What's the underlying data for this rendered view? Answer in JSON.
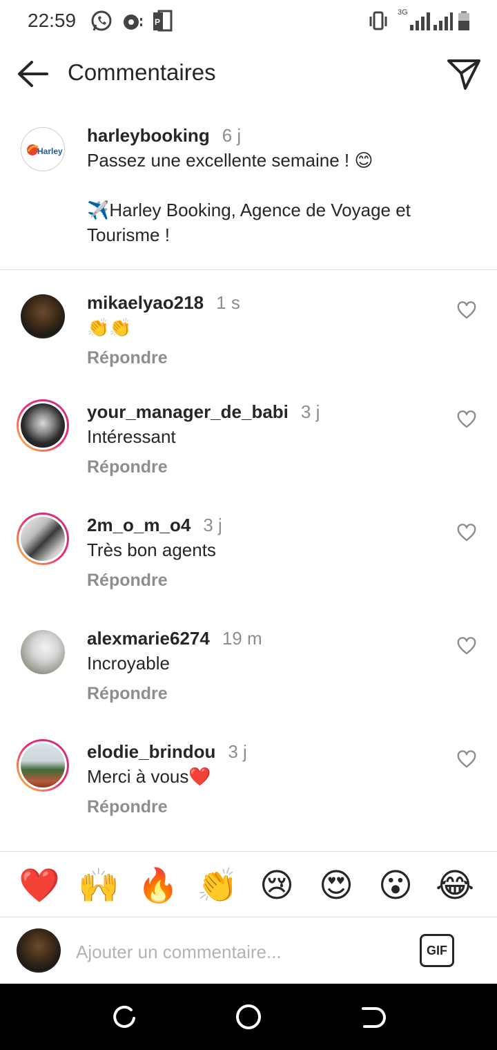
{
  "status_bar": {
    "time": "22:59",
    "left_icons": [
      "whatsapp-icon",
      "media-icon",
      "pdf-icon"
    ],
    "right_icons": [
      "vibrate-icon",
      "signal-3g-icon",
      "signal-icon",
      "battery-icon"
    ],
    "network_label": "3G"
  },
  "header": {
    "title": "Commentaires",
    "back_icon": "arrow-left-icon",
    "send_icon": "send-icon"
  },
  "caption": {
    "username": "harleybooking",
    "time": "6 j",
    "text": "Passez une excellente semaine ! 😊\n\n✈️Harley Booking, Agence de Voyage et Tourisme !",
    "avatar_label": "Harley"
  },
  "comments": [
    {
      "username": "mikaelyao218",
      "time": "1 s",
      "text": "👏👏",
      "reply": "Répondre",
      "story_ring": false
    },
    {
      "username": "your_manager_de_babi",
      "time": "3 j",
      "text": "Intéressant",
      "reply": "Répondre",
      "story_ring": true
    },
    {
      "username": "2m_o_m_o4",
      "time": "3 j",
      "text": "Très bon agents",
      "reply": "Répondre",
      "story_ring": true
    },
    {
      "username": "alexmarie6274",
      "time": "19 m",
      "text": "Incroyable",
      "reply": "Répondre",
      "story_ring": false
    },
    {
      "username": "elodie_brindou",
      "time": "3 j",
      "text": "Merci à vous❤️",
      "reply": "Répondre",
      "story_ring": true
    }
  ],
  "emoji_bar": [
    "❤️",
    "🙌",
    "🔥",
    "👏",
    "😢",
    "😍",
    "😮",
    "😂"
  ],
  "input": {
    "placeholder": "Ajouter un commentaire...",
    "value": "",
    "gif_label": "GIF"
  },
  "colors": {
    "text": "#262626",
    "muted": "#8e8e8e",
    "divider": "#dbdbdb",
    "story_gradient": [
      "#f9ce34",
      "#ee2a7b",
      "#c13584"
    ],
    "heart": "#ed4956"
  }
}
